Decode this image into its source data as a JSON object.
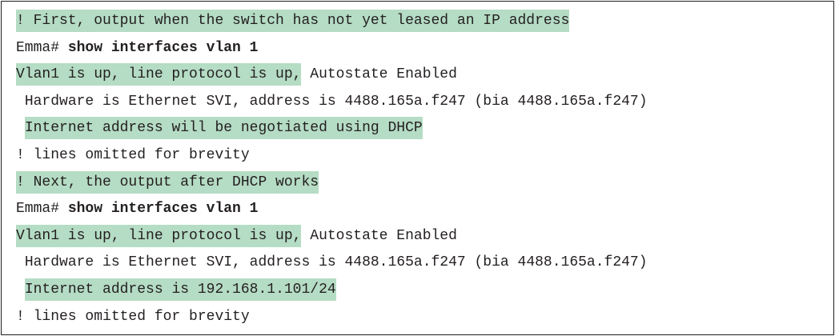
{
  "lines": [
    {
      "indent": "",
      "hl": "! First, output when the switch has not yet leased an IP address",
      "rest": ""
    },
    {
      "prompt": "Emma# ",
      "cmd": "show interfaces vlan 1"
    },
    {
      "indent": "",
      "hl": "Vlan1 is up, line protocol is up,",
      "rest": " Autostate Enabled"
    },
    {
      "indent": " ",
      "hl": "",
      "rest": "Hardware is Ethernet SVI, address is 4488.165a.f247 (bia 4488.165a.f247)"
    },
    {
      "indent": " ",
      "hl": "Internet address will be negotiated using DHCP",
      "rest": ""
    },
    {
      "indent": "",
      "hl": "",
      "rest": "! lines omitted for brevity"
    },
    {
      "indent": "",
      "hl": "! Next, the output after DHCP works",
      "rest": ""
    },
    {
      "prompt": "Emma# ",
      "cmd": "show interfaces vlan 1"
    },
    {
      "indent": "",
      "hl": "Vlan1 is up, line protocol is up,",
      "rest": " Autostate Enabled"
    },
    {
      "indent": " ",
      "hl": "",
      "rest": "Hardware is Ethernet SVI, address is 4488.165a.f247 (bia 4488.165a.f247)"
    },
    {
      "indent": " ",
      "hl": "Internet address is 192.168.1.101/24",
      "rest": ""
    },
    {
      "indent": "",
      "hl": "",
      "rest": "! lines omitted for brevity"
    }
  ],
  "colors": {
    "highlight": "#b5dcc4",
    "text": "#231f20",
    "border": "#231f20"
  }
}
